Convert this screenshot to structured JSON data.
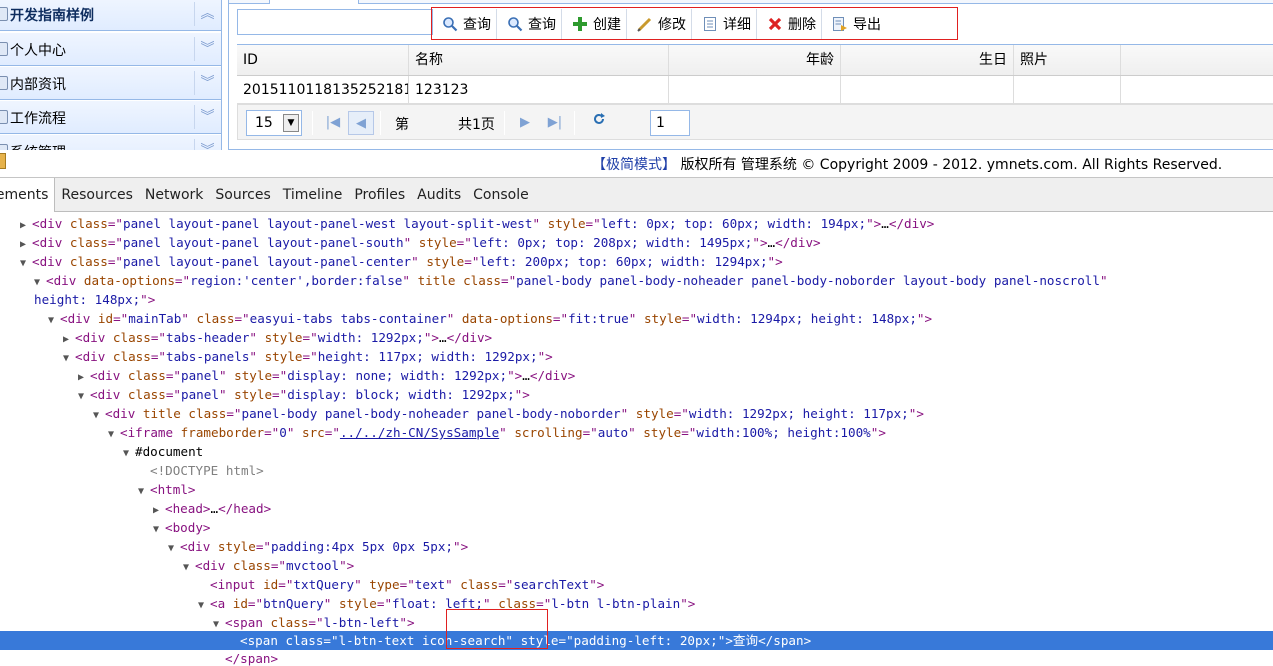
{
  "sidebar": {
    "items": [
      {
        "label": "开发指南样例",
        "selected": true,
        "chevron": "︽"
      },
      {
        "label": "个人中心",
        "selected": false,
        "chevron": "︾"
      },
      {
        "label": "内部资讯",
        "selected": false,
        "chevron": "︾"
      },
      {
        "label": "工作流程",
        "selected": false,
        "chevron": "︾"
      },
      {
        "label": "系统管理",
        "selected": false,
        "chevron": "︾"
      }
    ]
  },
  "toolbar": {
    "buttons": [
      {
        "label": "查询",
        "icon": "search-icon"
      },
      {
        "label": "查询",
        "icon": "search-icon"
      },
      {
        "label": "创建",
        "icon": "plus-icon"
      },
      {
        "label": "修改",
        "icon": "pencil-icon"
      },
      {
        "label": "详细",
        "icon": "document-icon"
      },
      {
        "label": "删除",
        "icon": "delete-x-icon"
      },
      {
        "label": "导出",
        "icon": "export-icon"
      }
    ],
    "search_value": ""
  },
  "grid": {
    "columns": [
      "ID",
      "名称",
      "年龄",
      "生日",
      "照片"
    ],
    "rows": [
      [
        "2015110118135252181",
        "123123",
        "",
        "",
        ""
      ]
    ]
  },
  "pager": {
    "page_size": "15",
    "page_prefix": "第",
    "page_value": "1",
    "page_total": "共1页"
  },
  "footer": {
    "mode_link": "【极简模式】",
    "copyright": " 版权所有 管理系统 © Copyright 2009 - 2012. ymnets.com. All Rights Reserved."
  },
  "devtools": {
    "tabs": [
      "lements",
      "Resources",
      "Network",
      "Sources",
      "Timeline",
      "Profiles",
      "Audits",
      "Console"
    ],
    "active_tab": "lements"
  },
  "colors": {
    "accent_border": "#95b8e7",
    "highlight_red": "#e02020",
    "selection_blue": "#3879d9",
    "tag_purple": "#881280",
    "attr_name": "#994500",
    "attr_value": "#1a1aa6"
  }
}
